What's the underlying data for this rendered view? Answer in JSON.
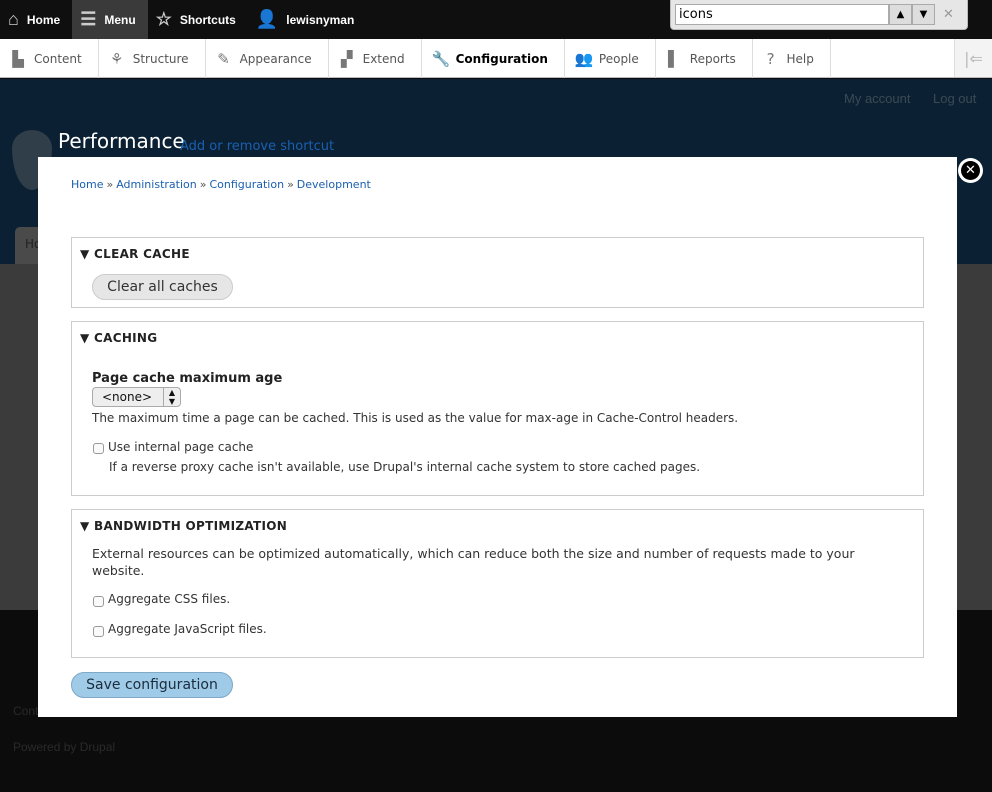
{
  "toolbar": {
    "home": "Home",
    "menu": "Menu",
    "shortcuts": "Shortcuts",
    "user": "lewisnyman"
  },
  "find": {
    "value": "icons"
  },
  "tray": {
    "items": [
      "Content",
      "Structure",
      "Appearance",
      "Extend",
      "Configuration",
      "People",
      "Reports",
      "Help"
    ],
    "active": "Configuration"
  },
  "header": {
    "my_account": "My account",
    "log_out": "Log out",
    "title": "Performance",
    "shortcut_link": "Add or remove shortcut",
    "tab": "Ho"
  },
  "footer": {
    "contact": "Cont",
    "powered": "Powered by Drupal"
  },
  "breadcrumb": [
    "Home",
    "Administration",
    "Configuration",
    "Development"
  ],
  "breadcrumb_sep": "»",
  "clear_cache": {
    "legend": "CLEAR CACHE",
    "button": "Clear all caches"
  },
  "caching": {
    "legend": "CACHING",
    "label": "Page cache maximum age",
    "select_value": "<none>",
    "description": "The maximum time a page can be cached. This is used as the value for max-age in Cache-Control headers.",
    "checkbox": "Use internal page cache",
    "checkbox_description": "If a reverse proxy cache isn't available, use Drupal's internal cache system to store cached pages.",
    "checked": false
  },
  "bandwidth": {
    "legend": "BANDWIDTH OPTIMIZATION",
    "description": "External resources can be optimized automatically, which can reduce both the size and number of requests made to your website.",
    "css": "Aggregate CSS files.",
    "js": "Aggregate JavaScript files.",
    "css_checked": false,
    "js_checked": false
  },
  "save": "Save configuration",
  "colors": {
    "link": "#1a5fb0",
    "primary_button": "#9fcbe8",
    "header_bg": "#0b2133"
  }
}
